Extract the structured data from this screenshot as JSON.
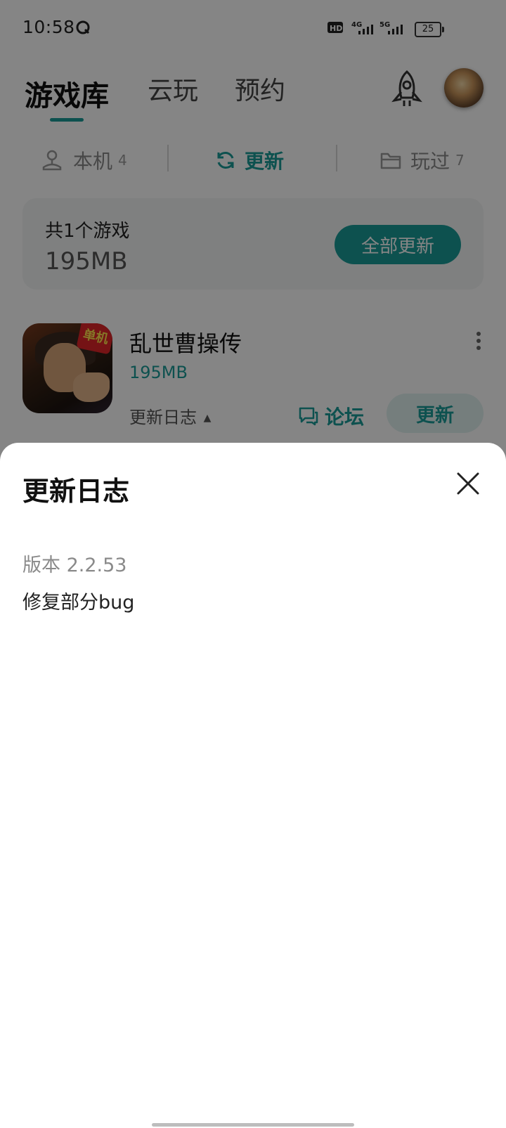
{
  "status_bar": {
    "time": "10:58",
    "network_1": "4G",
    "network_2": "5G",
    "battery": "25"
  },
  "nav": {
    "tabs": [
      {
        "label": "游戏库"
      },
      {
        "label": "云玩"
      },
      {
        "label": "预约"
      }
    ]
  },
  "filters": [
    {
      "label": "本机",
      "count": "4"
    },
    {
      "label": "更新",
      "count": ""
    },
    {
      "label": "玩过",
      "count": "7"
    }
  ],
  "summary": {
    "count_text": "共1个游戏",
    "total_size": "195MB",
    "update_all_label": "全部更新"
  },
  "game": {
    "name": "乱世曹操传",
    "size": "195MB",
    "badge": "单机",
    "changelog_label": "更新日志",
    "forum_label": "论坛",
    "update_label": "更新"
  },
  "sheet": {
    "title": "更新日志",
    "version": "版本 2.2.53",
    "notes": "修复部分bug"
  },
  "colors": {
    "accent": "#1a9c98",
    "overlay": "rgba(0,0,0,0.48)"
  }
}
